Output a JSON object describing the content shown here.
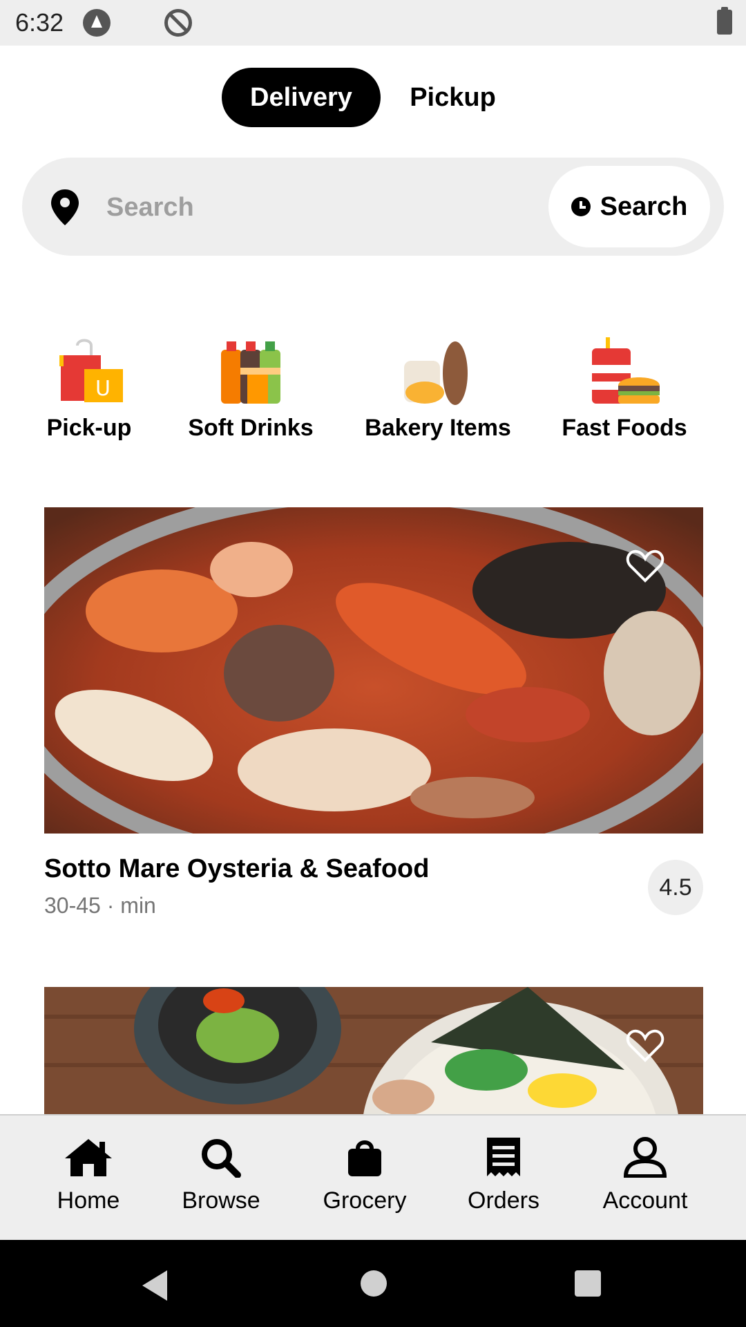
{
  "status_bar": {
    "time": "6:32"
  },
  "toggle": {
    "delivery": "Delivery",
    "pickup": "Pickup"
  },
  "search": {
    "placeholder": "Search",
    "button_label": "Search"
  },
  "categories": [
    {
      "label": "Pick-up",
      "icon": "shopping-bags-icon"
    },
    {
      "label": "Soft Drinks",
      "icon": "soft-drinks-icon"
    },
    {
      "label": "Bakery Items",
      "icon": "bakery-icon"
    },
    {
      "label": "Fast Foods",
      "icon": "fast-food-icon"
    }
  ],
  "restaurants": [
    {
      "name": "Sotto Mare Oysteria & Seafood",
      "time": "30-45 · min",
      "rating": "4.5",
      "image": "seafood-stew-photo"
    },
    {
      "image": "ramen-photo"
    }
  ],
  "bottom_nav": [
    {
      "label": "Home",
      "icon": "home-icon"
    },
    {
      "label": "Browse",
      "icon": "search-icon"
    },
    {
      "label": "Grocery",
      "icon": "shopping-bag-icon"
    },
    {
      "label": "Orders",
      "icon": "receipt-icon"
    },
    {
      "label": "Account",
      "icon": "account-icon"
    }
  ],
  "colors": {
    "accent": "#000000",
    "surface": "#eeeeee",
    "muted_text": "#757575"
  }
}
